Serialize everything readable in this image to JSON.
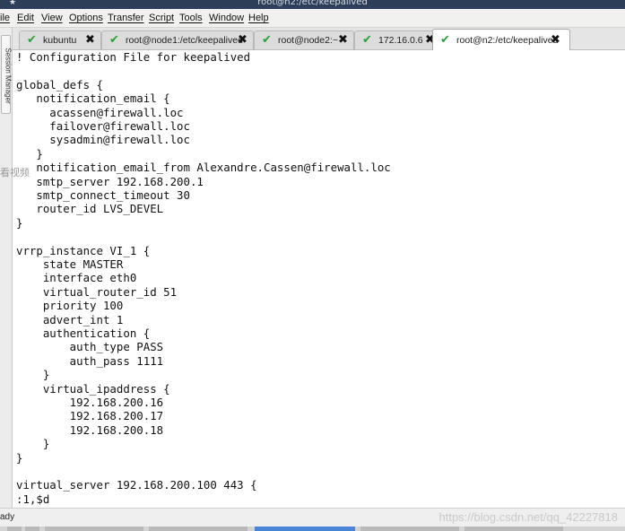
{
  "window": {
    "title": "root@n2:/etc/keepalived"
  },
  "menu": [
    "ile",
    "Edit",
    "View",
    "Options",
    "Transfer",
    "Script",
    "Tools",
    "Window",
    "Help"
  ],
  "tabs": [
    {
      "label": "kubuntu"
    },
    {
      "label": "root@node1:/etc/keepalived"
    },
    {
      "label": "root@node2:~"
    },
    {
      "label": "172.16.0.6"
    },
    {
      "label": "root@n2:/etc/keepalived"
    }
  ],
  "tab_close_glyph": "✖",
  "tab_check_glyph": "✔",
  "sidebar": {
    "session_manager": "Session Manager"
  },
  "ghost_text": "看视频",
  "terminal": {
    "lines": [
      "! Configuration File for keepalived",
      "",
      "global_defs {",
      "   notification_email {",
      "     acassen@firewall.loc",
      "     failover@firewall.loc",
      "     sysadmin@firewall.loc",
      "   }",
      "   notification_email_from Alexandre.Cassen@firewall.loc",
      "   smtp_server 192.168.200.1",
      "   smtp_connect_timeout 30",
      "   router_id LVS_DEVEL",
      "}",
      "",
      "vrrp_instance VI_1 {",
      "    state MASTER",
      "    interface eth0",
      "    virtual_router_id 51",
      "    priority 100",
      "    advert_int 1",
      "    authentication {",
      "        auth_type PASS",
      "        auth_pass 1111",
      "    }",
      "    virtual_ipaddress {",
      "        192.168.200.16",
      "        192.168.200.17",
      "        192.168.200.18",
      "    }",
      "}",
      "",
      "virtual_server 192.168.200.100 443 {",
      ":1,$d"
    ]
  },
  "status": {
    "text": "ady"
  },
  "watermark": "https://blog.csdn.net/qq_42227818"
}
